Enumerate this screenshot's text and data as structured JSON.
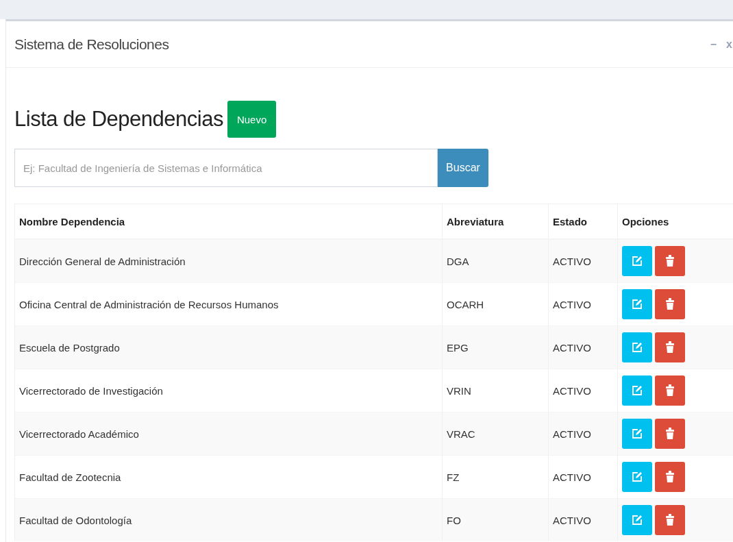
{
  "window": {
    "title": "Sistema de Resoluciones",
    "controls": [
      "−",
      "x"
    ]
  },
  "page": {
    "heading": "Lista de Dependencias",
    "new_button": "Nuevo"
  },
  "search": {
    "placeholder": "Ej: Facultad de Ingeniería de Sistemas e Informática",
    "button": "Buscar"
  },
  "table": {
    "columns": [
      "Nombre Dependencia",
      "Abreviatura",
      "Estado",
      "Opciones"
    ],
    "rows": [
      {
        "name": "Dirección General de Administración",
        "abbr": "DGA",
        "status": "ACTIVO"
      },
      {
        "name": "Oficina Central de Administración de Recursos Humanos",
        "abbr": "OCARH",
        "status": "ACTIVO"
      },
      {
        "name": "Escuela de Postgrado",
        "abbr": "EPG",
        "status": "ACTIVO"
      },
      {
        "name": "Vicerrectorado de Investigación",
        "abbr": "VRIN",
        "status": "ACTIVO"
      },
      {
        "name": "Vicerrectorado Académico",
        "abbr": "VRAC",
        "status": "ACTIVO"
      },
      {
        "name": "Facultad de Zootecnia",
        "abbr": "FZ",
        "status": "ACTIVO"
      },
      {
        "name": "Facultad de Odontología",
        "abbr": "FO",
        "status": "ACTIVO"
      }
    ]
  }
}
